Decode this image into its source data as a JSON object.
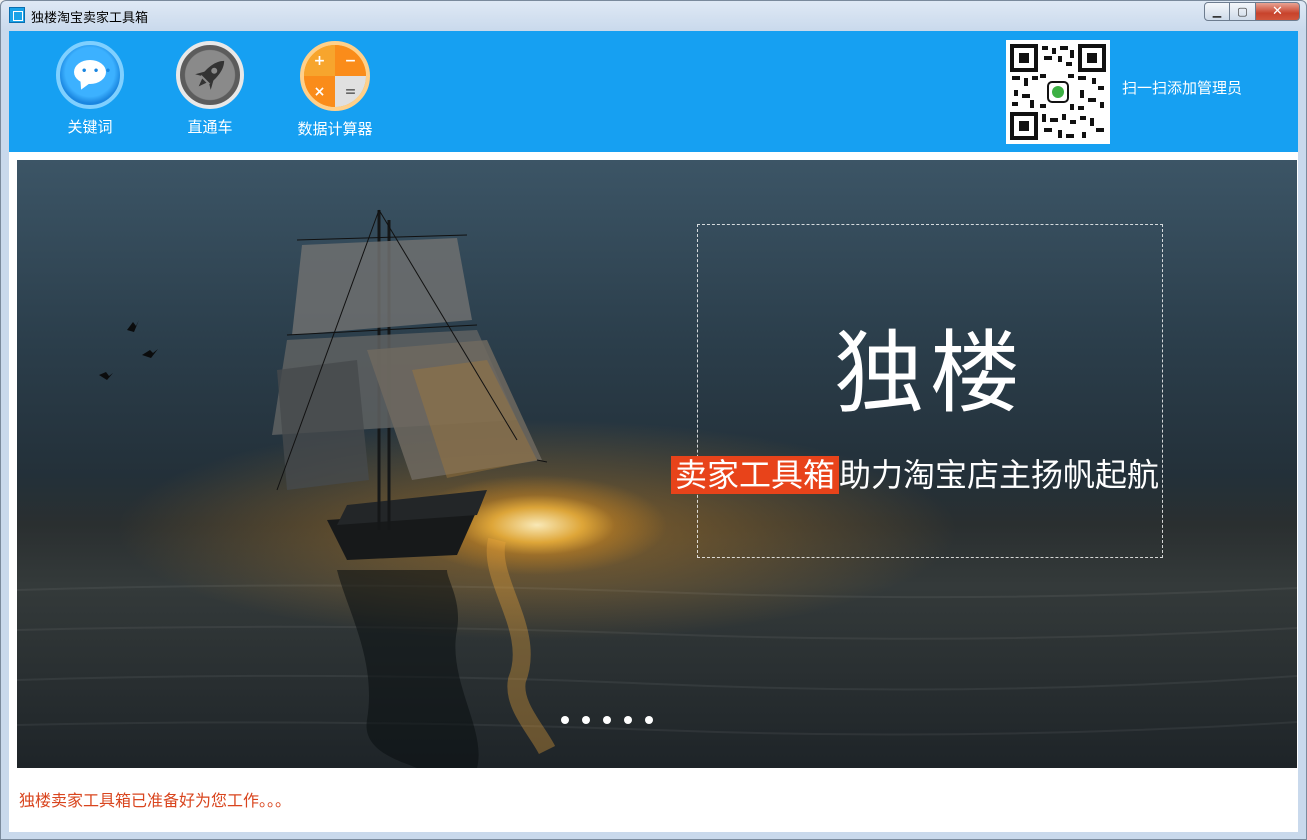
{
  "window": {
    "title": "独楼淘宝卖家工具箱"
  },
  "toolbar": {
    "items": [
      {
        "label": "关键词",
        "icon": "chat-bubble-icon"
      },
      {
        "label": "直通车",
        "icon": "rocket-icon"
      },
      {
        "label": "数据计算器",
        "icon": "calculator-icon"
      }
    ],
    "calc_symbols": [
      "+",
      "−",
      "×",
      "="
    ],
    "qr_label": "扫一扫添加管理员"
  },
  "banner": {
    "brand": "独楼",
    "slogan_highlight": "卖家工具箱",
    "slogan_rest": "助力淘宝店主扬帆起航",
    "pager_count": 5
  },
  "status": {
    "text": "独楼卖家工具箱已准备好为您工作。。。"
  },
  "colors": {
    "toolbar_bg": "#16a0f2",
    "status_text": "#d9451e",
    "highlight": "#e8431a"
  }
}
